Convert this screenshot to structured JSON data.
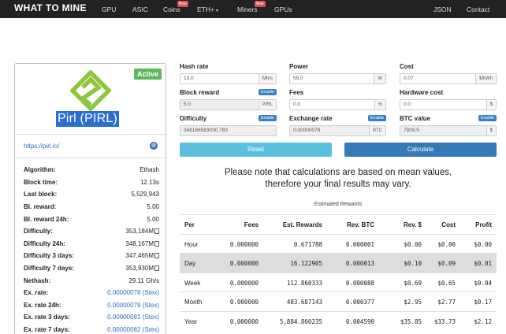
{
  "nav": {
    "brand": "WHAT TO MINE",
    "items": [
      {
        "label": "GPU"
      },
      {
        "label": "ASIC"
      },
      {
        "label": "Coins",
        "badge": "New"
      },
      {
        "label": "ETH+"
      },
      {
        "label": "Miners",
        "badge": "New"
      },
      {
        "label": "GPUs"
      }
    ],
    "right": [
      {
        "label": "JSON"
      },
      {
        "label": "Contact"
      }
    ]
  },
  "coin": {
    "status": "Active",
    "name": "Pirl (PIRL)",
    "url": "https://pirl.io/",
    "logo_color": "#8dc63f",
    "stats": [
      {
        "key": "Algorithm:",
        "value": "Ethash"
      },
      {
        "key": "Block time:",
        "value": "12.13s"
      },
      {
        "key": "Last block:",
        "value": "5,529,943"
      },
      {
        "key": "Bl. reward:",
        "value": "5.00"
      },
      {
        "key": "Bl. reward 24h:",
        "value": "5.00"
      },
      {
        "key": "Difficulty:",
        "value": "353,184M"
      },
      {
        "key": "Difficulty 24h:",
        "value": "348,167M"
      },
      {
        "key": "Difficulty 3 days:",
        "value": "347,465M"
      },
      {
        "key": "Difficulty 7 days:",
        "value": "353,930M"
      },
      {
        "key": "Nethash:",
        "value": "29.11 Gh/s"
      },
      {
        "key": "Ex. rate:",
        "value": "0.00000078 (Stex)"
      },
      {
        "key": "Ex. rate 24h:",
        "value": "0.00000079 (Stex)"
      },
      {
        "key": "Ex. rate 3 days:",
        "value": "0.00000081 (Stex)"
      },
      {
        "key": "Ex. rate 7 days:",
        "value": "0.00000082 (Stex)"
      }
    ]
  },
  "form": {
    "enable_label": "Enable",
    "fields": [
      {
        "label": "Hash rate",
        "value": "13.0",
        "unit": "Mh/s"
      },
      {
        "label": "Power",
        "value": "55.0",
        "unit": "W"
      },
      {
        "label": "Cost",
        "value": "0.07",
        "unit": "$/kWh"
      },
      {
        "label": "Block reward",
        "value": "5.0",
        "unit": "PIRL"
      },
      {
        "label": "Fees",
        "value": "0.0",
        "unit": "%"
      },
      {
        "label": "Hardware cost",
        "value": "0.0",
        "unit": "$"
      },
      {
        "label": "Difficulty",
        "value": "348166583030.783",
        "unit": ""
      },
      {
        "label": "Exchange rate",
        "value": "0.00000078",
        "unit": "BTC"
      },
      {
        "label": "BTC value",
        "value": "7809.5",
        "unit": "$"
      }
    ],
    "reset_label": "Reset",
    "calculate_label": "Calculate"
  },
  "note": {
    "line1": "Please note that calculations are based on mean values,",
    "line2": "therefore your final results may vary."
  },
  "rewards": {
    "title": "Estimated Rewards",
    "headers": [
      "Per",
      "Fees",
      "Est. Rewards",
      "Rev. BTC",
      "Rev. $",
      "Cost",
      "Profit"
    ],
    "rows": [
      [
        "Hour",
        "0.000000",
        "0.671788",
        "0.000001",
        "$0.00",
        "$0.00",
        "$0.00"
      ],
      [
        "Day",
        "0.000000",
        "16.122905",
        "0.000013",
        "$0.10",
        "$0.09",
        "$0.01"
      ],
      [
        "Week",
        "0.000000",
        "112.860333",
        "0.000088",
        "$0.69",
        "$0.65",
        "$0.04"
      ],
      [
        "Month",
        "0.000000",
        "483.687143",
        "0.000377",
        "$2.95",
        "$2.77",
        "$0.17"
      ],
      [
        "Year",
        "0.000000",
        "5,884.860235",
        "0.004590",
        "$35.85",
        "$33.73",
        "$2.12"
      ]
    ]
  }
}
